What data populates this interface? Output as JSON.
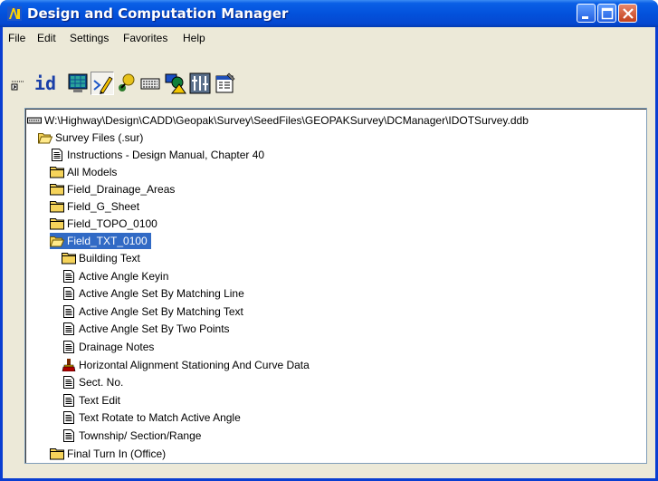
{
  "window": {
    "title": "Design and Computation Manager",
    "buttons": [
      "minimize",
      "maximize",
      "close"
    ]
  },
  "menu": [
    "File",
    "Edit",
    "Settings",
    "Favorites",
    "Help"
  ],
  "toolbar": {
    "id_label": "id",
    "tools": [
      "sensor-key-icon",
      "id-icon",
      "monitor-icon",
      "pencil-draw-icon",
      "query-icon",
      "keyboard-icon",
      "shapes-icon",
      "split-icon",
      "properties-icon"
    ]
  },
  "tree": {
    "root": "W:\\Highway\\Design\\CADD\\Geopak\\Survey\\SeedFiles\\GEOPAKSurvey\\DCManager\\IDOTSurvey.ddb",
    "category": "Survey Files (.sur)",
    "items": [
      {
        "label": "Instructions  - Design Manual, Chapter 40",
        "icon": "document-icon"
      },
      {
        "label": "All Models",
        "icon": "folder-icon"
      },
      {
        "label": "Field_Drainage_Areas",
        "icon": "folder-icon"
      },
      {
        "label": "Field_G_Sheet",
        "icon": "folder-icon"
      },
      {
        "label": "Field_TOPO_0100",
        "icon": "folder-icon"
      },
      {
        "label": "Field_TXT_0100",
        "icon": "folder-open-icon",
        "selected": true
      }
    ],
    "children": [
      {
        "label": "Building Text",
        "icon": "folder-icon"
      },
      {
        "label": "Active Angle Keyin",
        "icon": "document-icon"
      },
      {
        "label": "Active Angle Set By Matching Line",
        "icon": "document-icon"
      },
      {
        "label": "Active Angle Set By Matching Text",
        "icon": "document-icon"
      },
      {
        "label": "Active Angle Set By Two Points",
        "icon": "document-icon"
      },
      {
        "label": "Drainage Notes",
        "icon": "document-icon"
      },
      {
        "label": "Horizontal Alignment Stationing And Curve Data",
        "icon": "brush-icon"
      },
      {
        "label": "Sect. No.",
        "icon": "document-icon"
      },
      {
        "label": "Text Edit",
        "icon": "document-icon"
      },
      {
        "label": "Text Rotate to Match Active Angle",
        "icon": "document-icon"
      },
      {
        "label": "Township/ Section/Range",
        "icon": "document-icon"
      }
    ],
    "last": {
      "label": "Final Turn In (Office)",
      "icon": "folder-icon"
    }
  }
}
